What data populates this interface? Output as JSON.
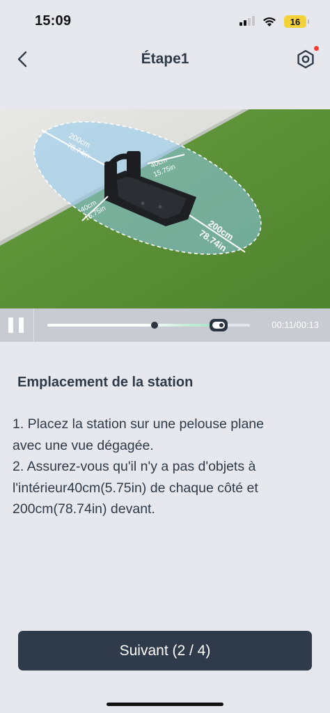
{
  "status_bar": {
    "time": "15:09",
    "battery_level": "16"
  },
  "nav": {
    "title": "Étape1",
    "back_icon": "chevron-left-icon",
    "settings_icon": "hexagon-gear-icon",
    "has_notification": true
  },
  "video": {
    "illustration": "mower-station-placement",
    "labels": {
      "back_cm": "200cm",
      "back_in": "78.74in",
      "side_right_cm": "40cm",
      "side_right_in": "15.75in",
      "side_left_cm": "40cm",
      "side_left_in": "15.75in",
      "front_cm": "200cm",
      "front_in": "78.74in"
    }
  },
  "player": {
    "pause_icon": "pause-icon",
    "progress": 0.846,
    "buffer_marker": 0.53,
    "time_text": "00:11/00:13"
  },
  "content": {
    "heading": "Emplacement de la station",
    "lines": [
      "1. Placez la station sur une pelouse plane",
      "avec une vue dégagée.",
      "2. Assurez-vous qu'il n'y a pas d'objets à",
      "l'intérieur40cm(5.75in) de chaque côté et",
      "200cm(78.74in) devant."
    ]
  },
  "footer": {
    "next_label": "Suivant (2 / 4)"
  },
  "colors": {
    "primary": "#2f3b4a",
    "background": "#e6e8ee",
    "zone": "#8ec9ef",
    "notification": "#ff3b30"
  }
}
